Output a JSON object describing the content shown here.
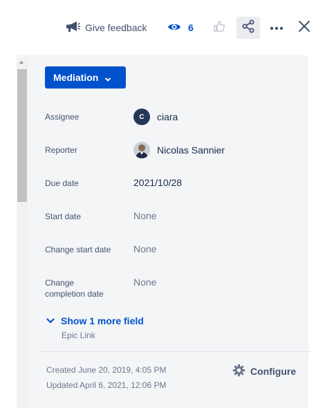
{
  "toolbar": {
    "feedback_label": "Give feedback",
    "watch_count": "6",
    "icons": [
      "megaphone-icon",
      "eye-icon",
      "thumbs-up-icon",
      "share-icon",
      "more-icon",
      "close-icon"
    ]
  },
  "status": {
    "label": "Mediation"
  },
  "fields": [
    {
      "label": "Assignee",
      "value": "ciara",
      "avatar_initial": "C"
    },
    {
      "label": "Reporter",
      "value": "Nicolas Sannier"
    },
    {
      "label": "Due date",
      "value": "2021/10/28"
    },
    {
      "label": "Start date",
      "value": "None"
    },
    {
      "label": "Change start date",
      "value": "None"
    },
    {
      "label_line1": "Change",
      "label_line2": "completion date",
      "value": "None"
    }
  ],
  "more_fields": {
    "label": "Show 1 more field",
    "sub": "Epic Link"
  },
  "meta": {
    "created": "Created June 20, 2019, 4:05 PM",
    "updated": "Updated April 6, 2021, 12:06 PM",
    "configure_label": "Configure"
  },
  "colors": {
    "accent": "#0052cc",
    "text": "#172b4d",
    "subtle": "#42526e",
    "muted": "#6b778c",
    "panel": "#f4f5f7"
  }
}
